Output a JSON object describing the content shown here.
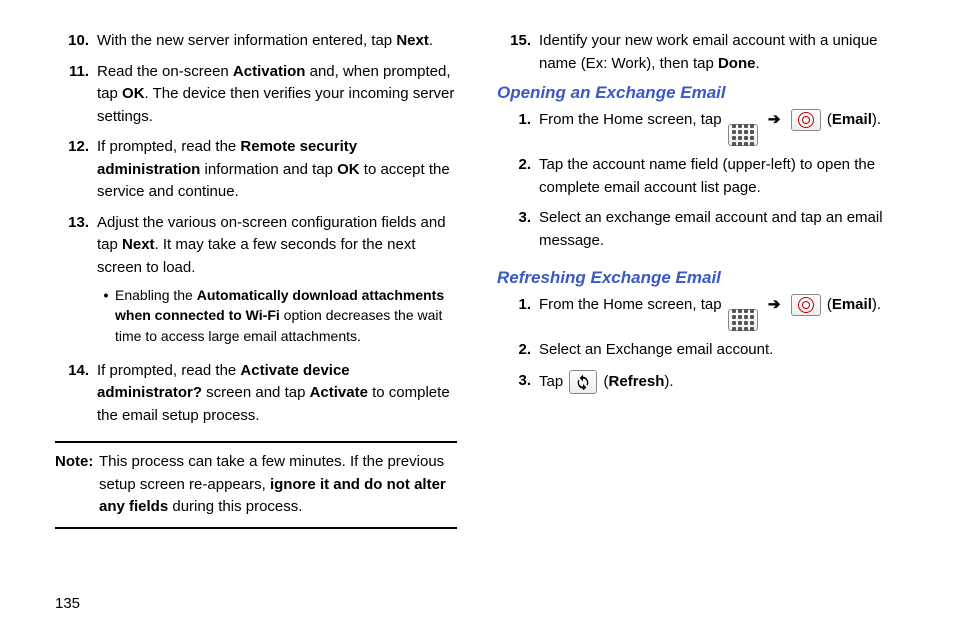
{
  "pageNumber": "135",
  "left": {
    "items": [
      {
        "num": "10.",
        "parts": [
          {
            "t": "With the new server information entered, tap "
          },
          {
            "t": "Next",
            "b": true
          },
          {
            "t": "."
          }
        ]
      },
      {
        "num": "11.",
        "parts": [
          {
            "t": "Read the on-screen "
          },
          {
            "t": "Activation",
            "b": true
          },
          {
            "t": " and, when prompted, tap "
          },
          {
            "t": "OK",
            "b": true
          },
          {
            "t": ". The device then verifies your incoming server settings."
          }
        ]
      },
      {
        "num": "12.",
        "parts": [
          {
            "t": "If prompted, read the "
          },
          {
            "t": "Remote security administration",
            "b": true
          },
          {
            "t": " information and tap "
          },
          {
            "t": "OK",
            "b": true
          },
          {
            "t": " to accept the service and continue."
          }
        ]
      },
      {
        "num": "13.",
        "parts": [
          {
            "t": "Adjust the various on-screen configuration fields and tap "
          },
          {
            "t": "Next",
            "b": true
          },
          {
            "t": ". It may take a few seconds for the next screen to load."
          }
        ],
        "sub": [
          {
            "parts": [
              {
                "t": "Enabling the "
              },
              {
                "t": "Automatically download attachments when connected to Wi-Fi",
                "b": true
              },
              {
                "t": " option decreases the wait time to access large email attachments."
              }
            ]
          }
        ]
      },
      {
        "num": "14.",
        "parts": [
          {
            "t": "If prompted, read the "
          },
          {
            "t": "Activate device administrator?",
            "b": true
          },
          {
            "t": " screen and tap "
          },
          {
            "t": "Activate",
            "b": true
          },
          {
            "t": " to complete the email setup process."
          }
        ]
      }
    ],
    "note": {
      "label": "Note:",
      "parts": [
        {
          "t": "This process can take a few minutes. If the previous setup screen re-appears, "
        },
        {
          "t": "ignore it and do not alter any fields",
          "b": true
        },
        {
          "t": " during this process."
        }
      ]
    }
  },
  "right": {
    "top": [
      {
        "num": "15.",
        "parts": [
          {
            "t": "Identify your new work email account with a unique name (Ex: Work), then tap "
          },
          {
            "t": "Done",
            "b": true
          },
          {
            "t": "."
          }
        ]
      }
    ],
    "sections": [
      {
        "heading": "Opening an Exchange Email",
        "items": [
          {
            "num": "1.",
            "parts": [
              {
                "t": "From the Home screen, tap "
              },
              {
                "icon": "apps"
              },
              {
                "t": " "
              },
              {
                "arrow": true
              },
              {
                "t": " "
              },
              {
                "icon": "email"
              },
              {
                "t": " ("
              },
              {
                "t": "Email",
                "b": true
              },
              {
                "t": ")."
              }
            ]
          },
          {
            "num": "2.",
            "parts": [
              {
                "t": "Tap the account name field (upper-left) to open the complete email account list page."
              }
            ]
          },
          {
            "num": "3.",
            "parts": [
              {
                "t": "Select an exchange email account and tap an email message."
              }
            ]
          }
        ]
      },
      {
        "heading": "Refreshing Exchange Email",
        "items": [
          {
            "num": "1.",
            "parts": [
              {
                "t": "From the Home screen, tap "
              },
              {
                "icon": "apps"
              },
              {
                "t": " "
              },
              {
                "arrow": true
              },
              {
                "t": " "
              },
              {
                "icon": "email"
              },
              {
                "t": " ("
              },
              {
                "t": "Email",
                "b": true
              },
              {
                "t": ")."
              }
            ]
          },
          {
            "num": "2.",
            "parts": [
              {
                "t": "Select an Exchange email account."
              }
            ]
          },
          {
            "num": "3.",
            "parts": [
              {
                "t": "Tap "
              },
              {
                "icon": "refresh"
              },
              {
                "t": " ("
              },
              {
                "t": "Refresh",
                "b": true
              },
              {
                "t": ")."
              }
            ]
          }
        ]
      }
    ]
  }
}
